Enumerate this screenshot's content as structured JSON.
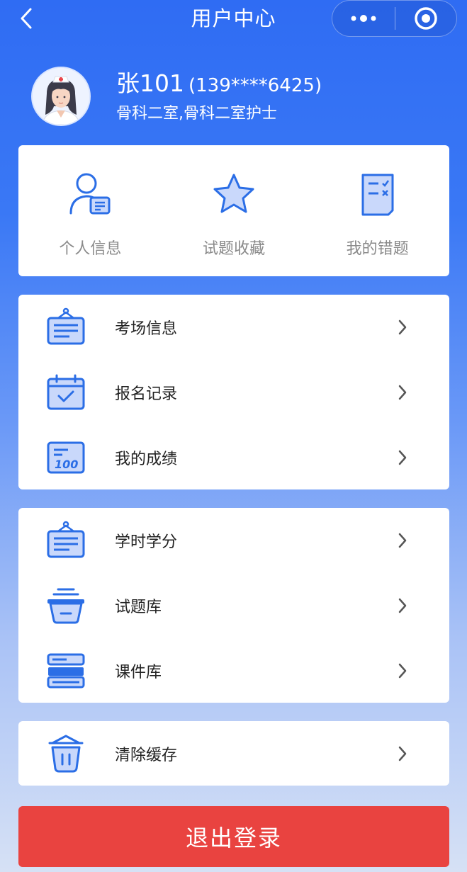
{
  "nav": {
    "title": "用户中心"
  },
  "user": {
    "name": "张101",
    "phone": "(139****6425)",
    "department": "骨科二室,骨科二室护士"
  },
  "quick_actions": [
    {
      "label": "个人信息",
      "icon": "person-card-icon"
    },
    {
      "label": "试题收藏",
      "icon": "star-icon"
    },
    {
      "label": "我的错题",
      "icon": "wrong-questions-icon"
    }
  ],
  "menu_group_1": [
    {
      "label": "考场信息",
      "icon": "notice-board-icon"
    },
    {
      "label": "报名记录",
      "icon": "calendar-check-icon"
    },
    {
      "label": "我的成绩",
      "icon": "score-100-icon"
    }
  ],
  "menu_group_2": [
    {
      "label": "学时学分",
      "icon": "notice-board-icon"
    },
    {
      "label": "试题库",
      "icon": "basket-icon"
    },
    {
      "label": "课件库",
      "icon": "courseware-stack-icon"
    }
  ],
  "menu_group_3": [
    {
      "label": "清除缓存",
      "icon": "trash-icon"
    }
  ],
  "logout_label": "退出登录",
  "colors": {
    "primary": "#2f6cf3",
    "icon_blue": "#2b6ee6",
    "icon_fill": "#c9d8fb",
    "logout_red": "#e94340"
  }
}
